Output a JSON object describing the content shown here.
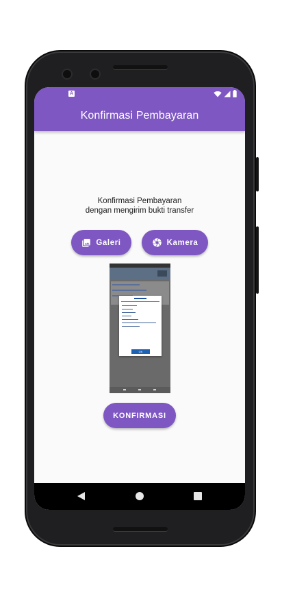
{
  "appbar": {
    "title": "Konfirmasi Pembayaran",
    "color": "#7e57c2",
    "status_left_icon": "a-notification-icon",
    "status_right_icons": [
      "wifi-icon",
      "cell-signal-icon",
      "battery-icon"
    ]
  },
  "main": {
    "subtitle_line1": "Konfirmasi Pembayaran",
    "subtitle_line2": "dengan mengirim bukti transfer",
    "galeri_label": "Galeri",
    "galeri_icon": "image-icon",
    "kamera_label": "Kamera",
    "kamera_icon": "camera-aperture-icon",
    "konfirmasi_label": "KONFIRMASI",
    "receipt_image_label": "payment-receipt-screenshot",
    "receipt_dialog_title": "m-Transfer",
    "receipt_ok": "OK"
  },
  "navbar": {
    "icons": [
      "back-icon",
      "home-icon",
      "recents-icon"
    ]
  }
}
